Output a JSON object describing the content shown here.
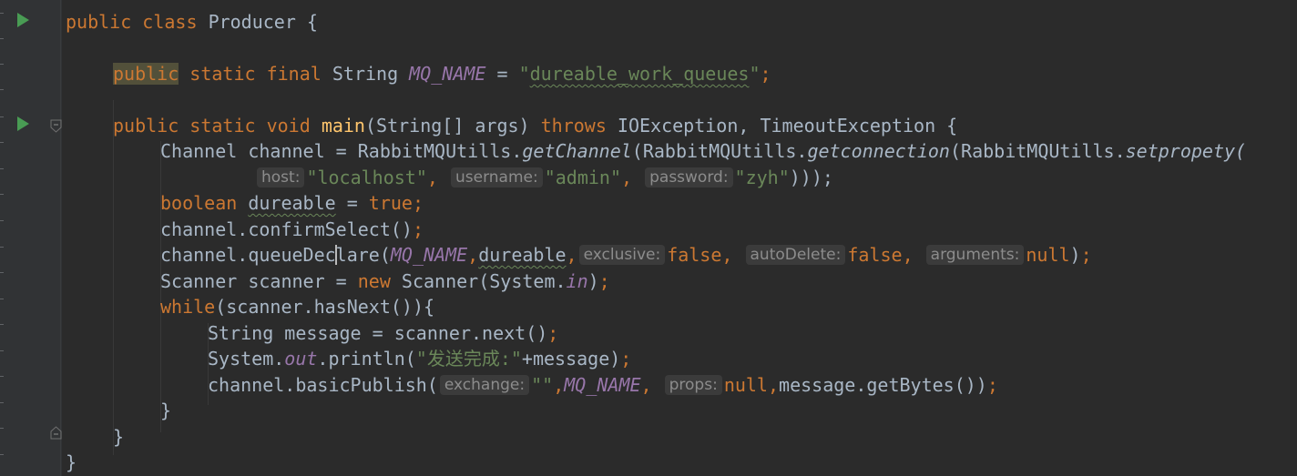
{
  "editor": {
    "line1": {
      "kw1": "public",
      "kw2": "class",
      "name": "Producer",
      "brace": " {"
    },
    "line3": {
      "kw1": "public",
      "kw2": "static",
      "kw3": "final",
      "type": "String",
      "const": "MQ_NAME",
      "eq": " = ",
      "strq1": "\"",
      "strval": "dureable_work_queues",
      "strq2": "\"",
      "semi": ";"
    },
    "line5": {
      "kw1": "public",
      "kw2": "static",
      "kw3": "void",
      "fn": "main",
      "p1": "(String[] args) ",
      "kw4": "throws",
      "p2": " IOException, TimeoutException {"
    },
    "line6": {
      "t1": "Channel channel = RabbitMQUtills.",
      "m1": "getChannel",
      "t2": "(RabbitMQUtills.",
      "m2": "getconnection",
      "t3": "(RabbitMQUtills.",
      "m3": "setpropety("
    },
    "line7": {
      "h1": "host:",
      "s1": "\"localhost\"",
      "c1": ",",
      "h2": "username:",
      "s2": "\"admin\"",
      "c2": ",",
      "h3": "password:",
      "s3": "\"zyh\"",
      "end": ")));"
    },
    "line8": {
      "kw": "boolean",
      "var": "dureable",
      "eq": " = ",
      "val": "true",
      "semi": ";"
    },
    "line9": {
      "text": "channel.confirmSelect()",
      "semi": ";"
    },
    "line10": {
      "t1": "channel.queueDec",
      "t1b": "lare(",
      "const": "MQ_NAME",
      "comma1": ",",
      "var": "dureable",
      "comma2": ",",
      "h1": "exclusive:",
      "v1": "false",
      "c1": ",",
      "h2": "autoDelete:",
      "v2": "false",
      "c2": ",",
      "h3": "arguments:",
      "v3": "null",
      "end": ")",
      "semi": ";"
    },
    "line11": {
      "t1": "Scanner scanner = ",
      "kw": "new",
      "t2": " Scanner(System.",
      "field": "in",
      "end": ")",
      "semi": ";"
    },
    "line12": {
      "kw": "while",
      "t": "(scanner.hasNext()){"
    },
    "line13": {
      "t": "String message = scanner.next()",
      "semi": ";"
    },
    "line14": {
      "t1": "System.",
      "field": "out",
      "t2": ".println(",
      "str": "\"发送完成:\"",
      "t3": "+message)",
      "semi": ";"
    },
    "line15": {
      "t1": "channel.basicPublish(",
      "h1": "exchange:",
      "s1": "\"\"",
      "c1": ",",
      "const": "MQ_NAME",
      "c2": ",",
      "h2": "props:",
      "v": "null",
      "c3": ",",
      "t2": "message.getBytes())",
      "semi": ";"
    },
    "line16": {
      "t": "}"
    },
    "line17": {
      "t": "}"
    },
    "line18": {
      "t": "}"
    }
  },
  "gutter": {
    "icons": [
      "run-class-icon",
      "run-main-icon",
      "fold-method-icon",
      "fold-end-icon"
    ]
  }
}
